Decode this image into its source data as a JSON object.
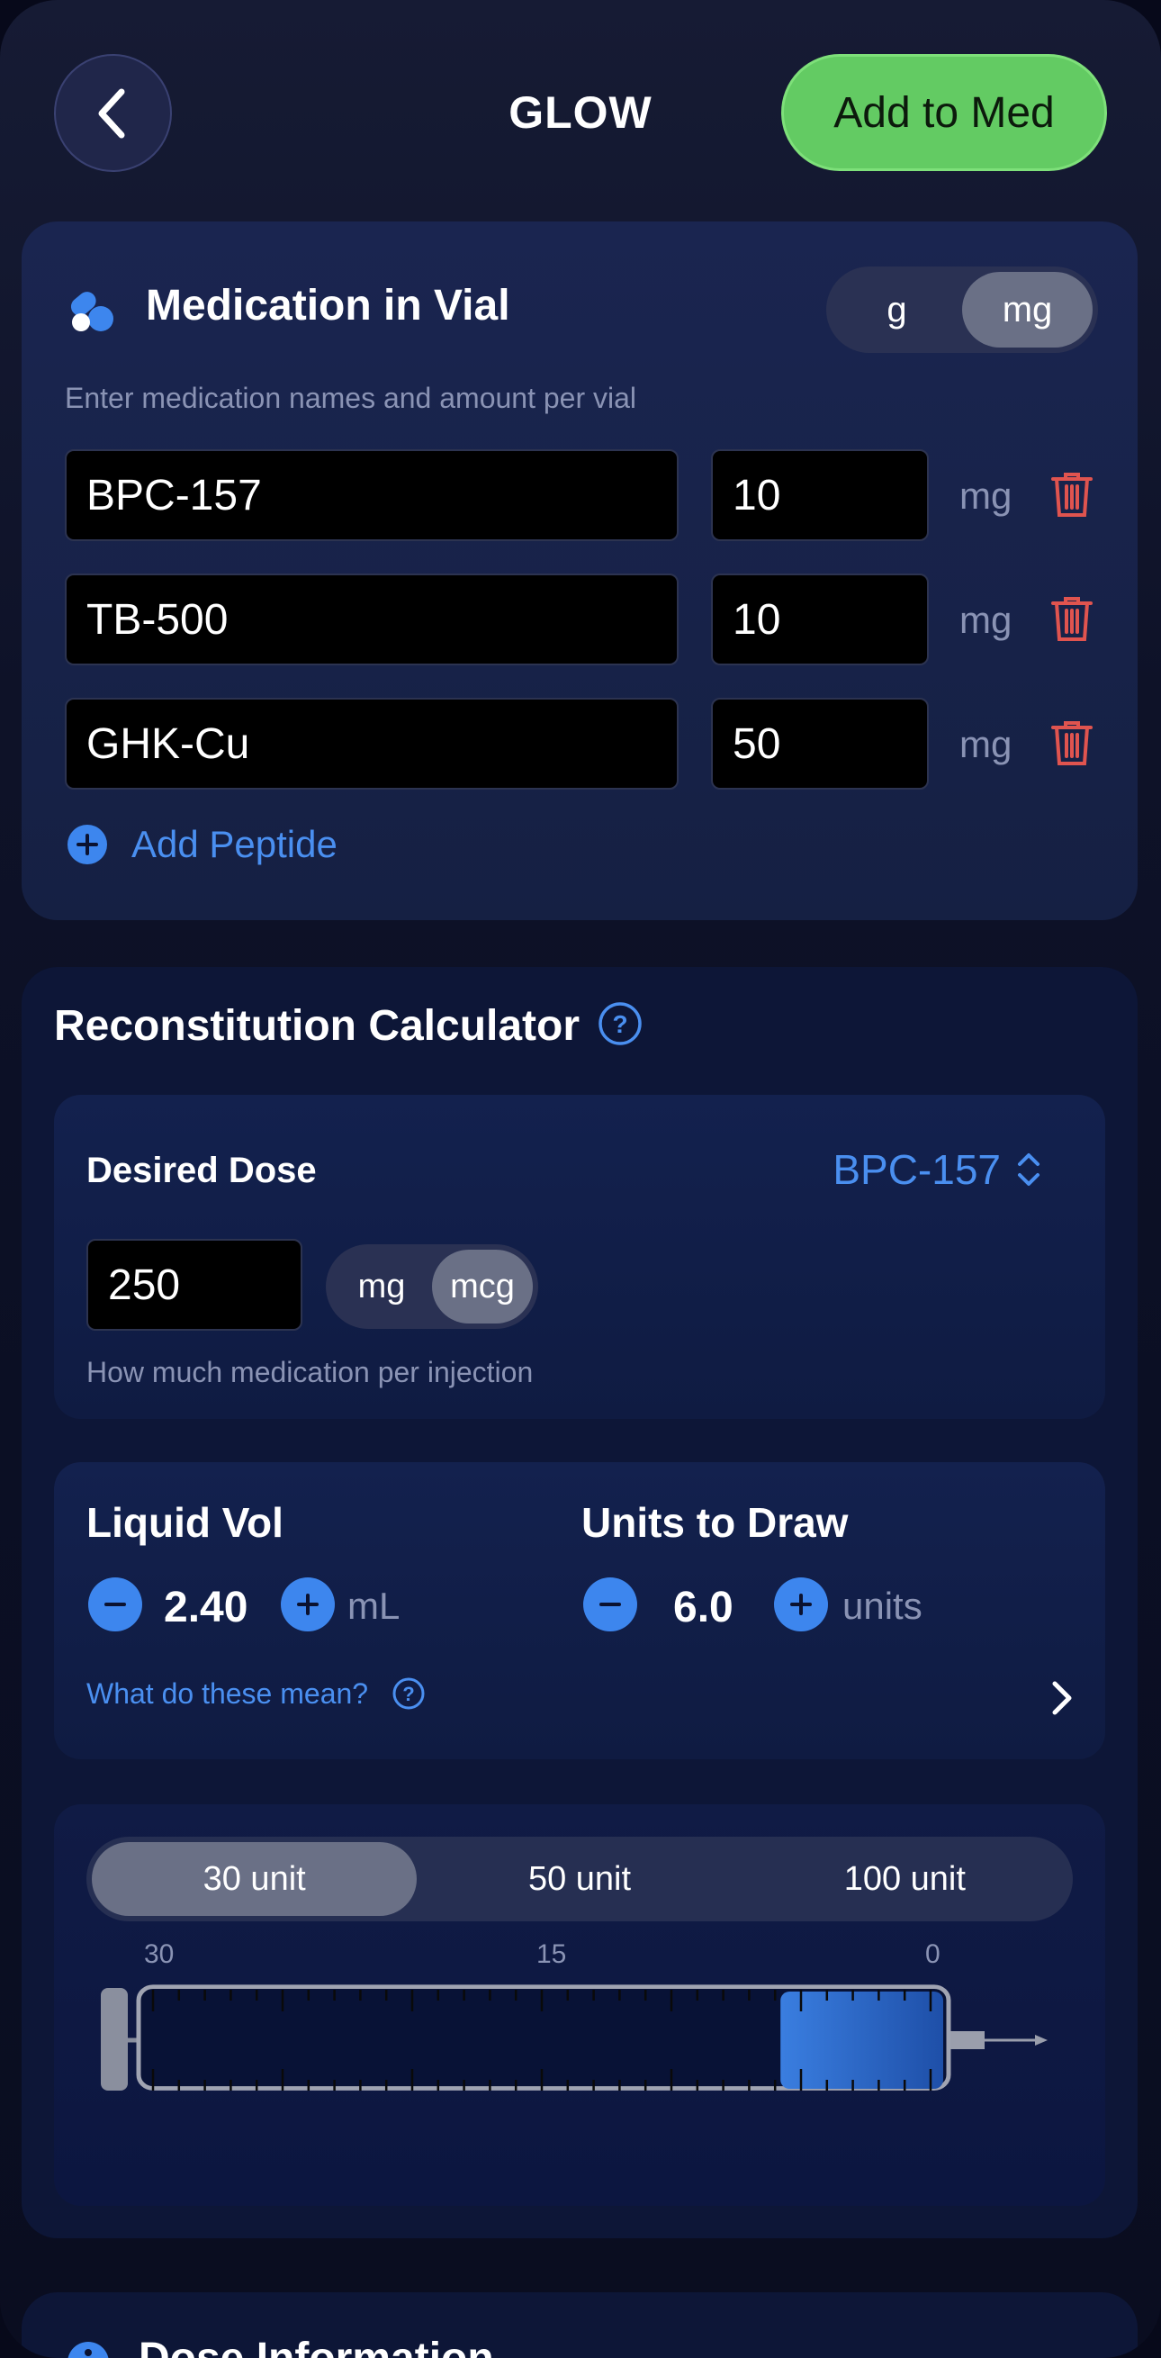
{
  "header": {
    "title": "GLOW",
    "add_button": "Add to Med"
  },
  "medication": {
    "title": "Medication in Vial",
    "unit_options": [
      "g",
      "mg"
    ],
    "selected_unit": "mg",
    "subtitle": "Enter medication names and amount per vial",
    "rows": [
      {
        "name": "BPC-157",
        "amount": "10",
        "unit": "mg"
      },
      {
        "name": "TB-500",
        "amount": "10",
        "unit": "mg"
      },
      {
        "name": "GHK-Cu",
        "amount": "50",
        "unit": "mg"
      }
    ],
    "add_label": "Add Peptide"
  },
  "calculator": {
    "title": "Reconstitution Calculator",
    "help_icon": "question-circle-icon",
    "desired_dose": {
      "label": "Desired Dose",
      "selected_peptide": "BPC-157",
      "value": "250",
      "unit_options": [
        "mg",
        "mcg"
      ],
      "selected_unit": "mcg",
      "hint": "How much medication per injection"
    },
    "liquid_vol": {
      "label": "Liquid Vol",
      "value": "2.40",
      "unit": "mL"
    },
    "units_to_draw": {
      "label": "Units to Draw",
      "value": "6.0",
      "unit": "units"
    },
    "explain_link": "What do these mean?",
    "syringe": {
      "sizes": [
        "30 unit",
        "50 unit",
        "100 unit"
      ],
      "selected": "30 unit",
      "scale_labels": [
        "30",
        "15",
        "0"
      ],
      "fill_units": 6.0,
      "capacity_units": 30
    }
  },
  "next_section": {
    "title": "Dose Information"
  },
  "colors": {
    "accent": "#4a8ff0",
    "add_button": "#63cb63",
    "danger": "#e0544f",
    "background": "#0e1228"
  }
}
